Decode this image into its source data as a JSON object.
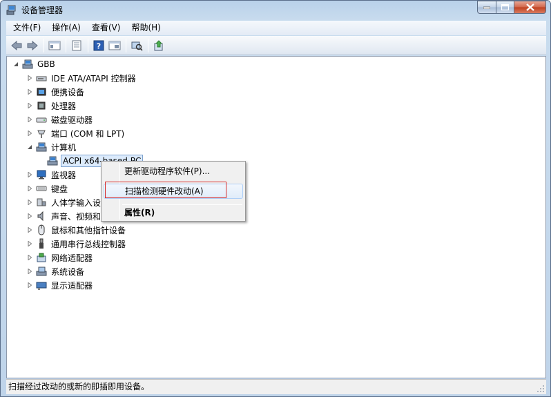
{
  "window": {
    "title": "设备管理器"
  },
  "menu": {
    "items": [
      "文件(F)",
      "操作(A)",
      "查看(V)",
      "帮助(H)"
    ]
  },
  "tree": {
    "root": "GBB",
    "categories": [
      {
        "label": "IDE ATA/ATAPI 控制器",
        "icon": "ide-controller-icon",
        "expanded": false
      },
      {
        "label": "便携设备",
        "icon": "portable-device-icon",
        "expanded": false
      },
      {
        "label": "处理器",
        "icon": "processor-icon",
        "expanded": false
      },
      {
        "label": "磁盘驱动器",
        "icon": "disk-drive-icon",
        "expanded": false
      },
      {
        "label": "端口 (COM 和 LPT)",
        "icon": "port-icon",
        "expanded": false
      },
      {
        "label": "计算机",
        "icon": "computer-icon",
        "expanded": true
      },
      {
        "label": "ACPI x64-based PC",
        "icon": "computer-icon",
        "child": true,
        "selected": true
      },
      {
        "label": "监视器",
        "icon": "monitor-icon",
        "expanded": false
      },
      {
        "label": "键盘",
        "icon": "keyboard-icon",
        "expanded": false
      },
      {
        "label": "人体学输入设",
        "icon": "hid-icon",
        "expanded": false
      },
      {
        "label": "声音、视频和",
        "icon": "sound-icon",
        "expanded": false
      },
      {
        "label": "鼠标和其他指针设备",
        "icon": "mouse-icon",
        "expanded": false
      },
      {
        "label": "通用串行总线控制器",
        "icon": "usb-icon",
        "expanded": false
      },
      {
        "label": "网络适配器",
        "icon": "network-icon",
        "expanded": false
      },
      {
        "label": "系统设备",
        "icon": "system-device-icon",
        "expanded": false
      },
      {
        "label": "显示适配器",
        "icon": "display-adapter-icon",
        "expanded": false
      }
    ]
  },
  "context_menu": {
    "update_driver": "更新驱动程序软件(P)...",
    "scan_hardware": "扫描检测硬件改动(A)",
    "properties": "属性(R)"
  },
  "status": {
    "text": "扫描经过改动的或新的即插即用设备。"
  },
  "colors": {
    "highlight_box": "#d62b2b",
    "selection": "#dcebfc"
  }
}
